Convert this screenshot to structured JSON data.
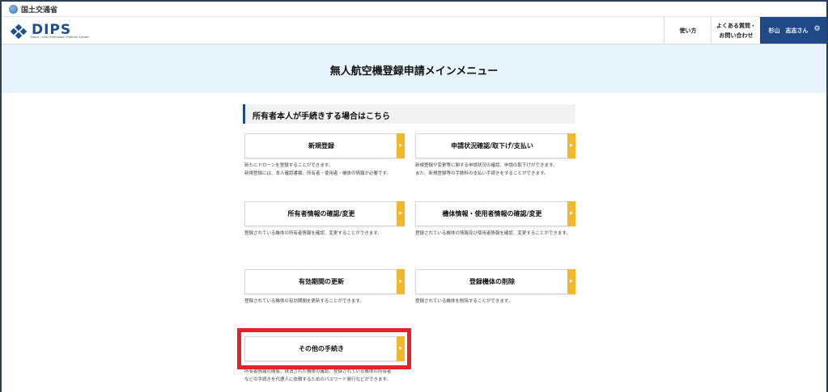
{
  "mlit": {
    "name": "国土交通省"
  },
  "brand": {
    "logo_text": "DIPS",
    "logo_sub": "Drone / UAS Information Platform System"
  },
  "header": {
    "nav_usage": "使い方",
    "nav_faq_line1": "よくある質問・",
    "nav_faq_line2": "お問い合わせ",
    "user_name": "杉山　志志さん"
  },
  "page": {
    "title": "無人航空機登録申請メインメニュー"
  },
  "section": {
    "title": "所有者本人が手続きする場合はこちら"
  },
  "cards": [
    {
      "label": "新規登録",
      "desc": [
        "新たにドローンを登録することができます。",
        "新規登録には、本人確認書類、所有者・使用者・機体の情報が必要です。"
      ]
    },
    {
      "label": "申請状況確認/取下げ/支払い",
      "desc": [
        "新規登録や変更等に関する申請状況の確認、申請の取下げができます。",
        "また、新規登録等の手数料の支払い手続きをすることができます。"
      ]
    },
    {
      "label": "所有者情報の確認/変更",
      "desc": [
        "登録されている機体の所有者情報を確認、変更することができます。"
      ]
    },
    {
      "label": "機体情報・使用者情報の確認/変更",
      "desc": [
        "登録されている機体の情報及び使用者情報を確認、変更することができます。"
      ]
    },
    {
      "label": "有効期間の更新",
      "desc": [
        "登録されている機体の有効期間を更新することができます。"
      ]
    },
    {
      "label": "登録機体の削除",
      "desc": [
        "登録されている機体を削除することができます。"
      ]
    },
    {
      "label": "その他の手続き",
      "desc": [
        "所有者情報の閲覧、抹消された機体の確認、登録されている機体の所有者",
        "などの手続きを代理人に依頼するためのパスワード発行などができます。"
      ]
    }
  ],
  "colors": {
    "accent": "#1f4a86",
    "tab": "#f0b82d",
    "highlight": "#e3222a",
    "hero_bg": "#e6f3fb"
  }
}
